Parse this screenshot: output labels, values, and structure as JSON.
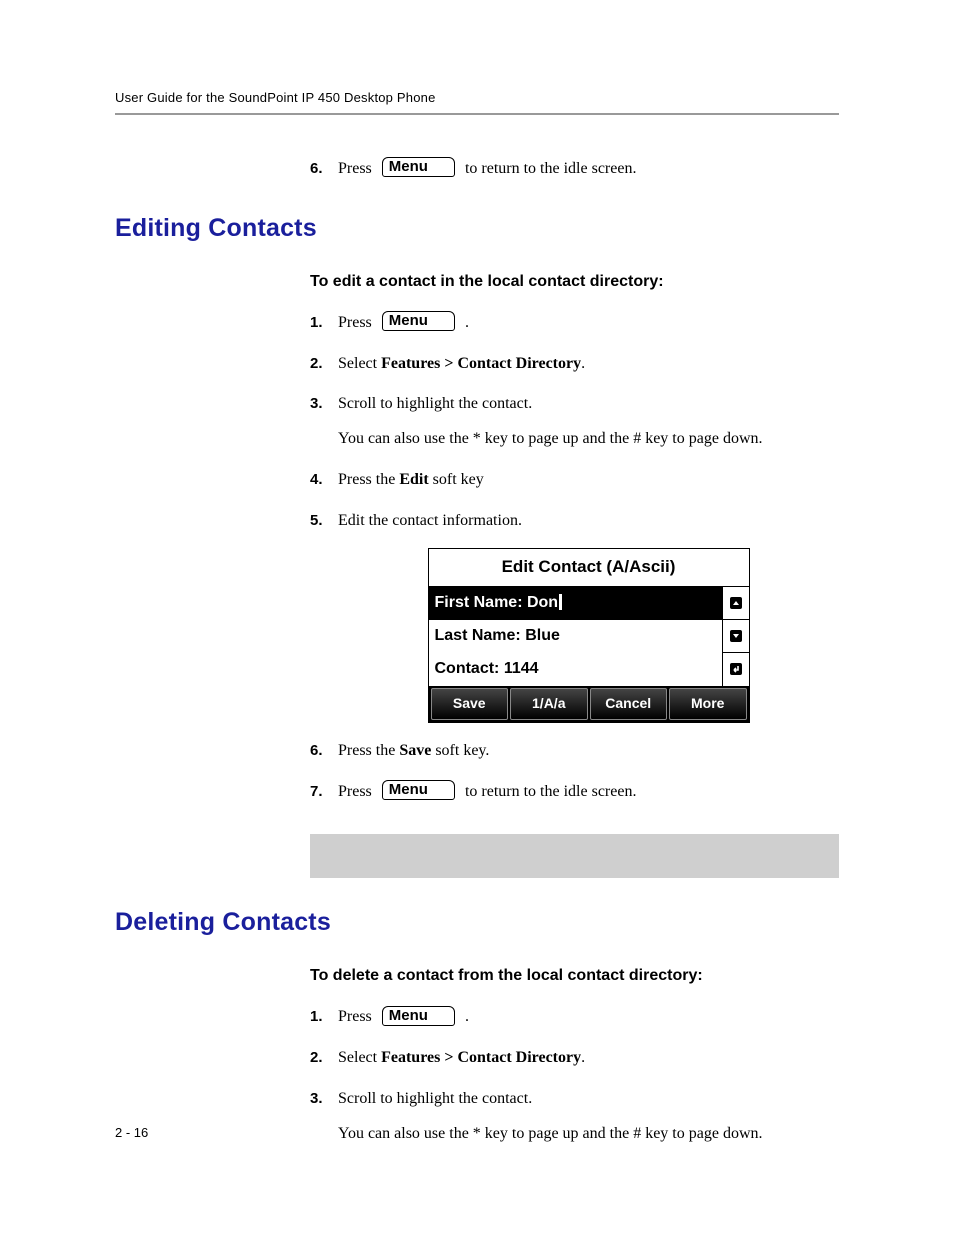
{
  "header": "User Guide for the SoundPoint IP 450 Desktop Phone",
  "page_num": "2 - 16",
  "menu_label": "Menu",
  "top_step": {
    "num_start": 6,
    "press": "Press ",
    "after": " to return to the idle screen."
  },
  "section_edit": {
    "heading": "Editing Contacts",
    "intro": "To edit a contact in the local contact directory:",
    "steps": [
      {
        "pre": "Press ",
        "has_menu": true,
        "post": " ."
      },
      {
        "pre": "Select ",
        "bold": "Features > Contact Directory",
        "post": "."
      },
      {
        "pre": "Scroll to highlight the contact.",
        "sub": "You can also use the * key to page up and the # key to page down."
      },
      {
        "pre": "Press the ",
        "bold": "Edit",
        "post": " soft key"
      },
      {
        "pre": "Edit the contact information."
      },
      {
        "pre": "Press the ",
        "bold": "Save",
        "post": " soft key."
      },
      {
        "pre": "Press ",
        "has_menu": true,
        "post": " to return to the idle screen."
      }
    ]
  },
  "phone": {
    "title": "Edit Contact (A/Ascii)",
    "line1_label": "First Name: ",
    "line1_value": "Don",
    "line2": "Last Name: Blue",
    "line3": "Contact: 1144",
    "softkeys": [
      "Save",
      "1/A/a",
      "Cancel",
      "More"
    ]
  },
  "section_delete": {
    "heading": "Deleting Contacts",
    "intro": "To delete a contact from the local contact directory:",
    "steps": [
      {
        "pre": "Press ",
        "has_menu": true,
        "post": " ."
      },
      {
        "pre": "Select ",
        "bold": "Features > Contact Directory",
        "post": "."
      },
      {
        "pre": "Scroll to highlight the contact.",
        "sub": "You can also use the * key to page up and the # key to page down."
      }
    ]
  }
}
